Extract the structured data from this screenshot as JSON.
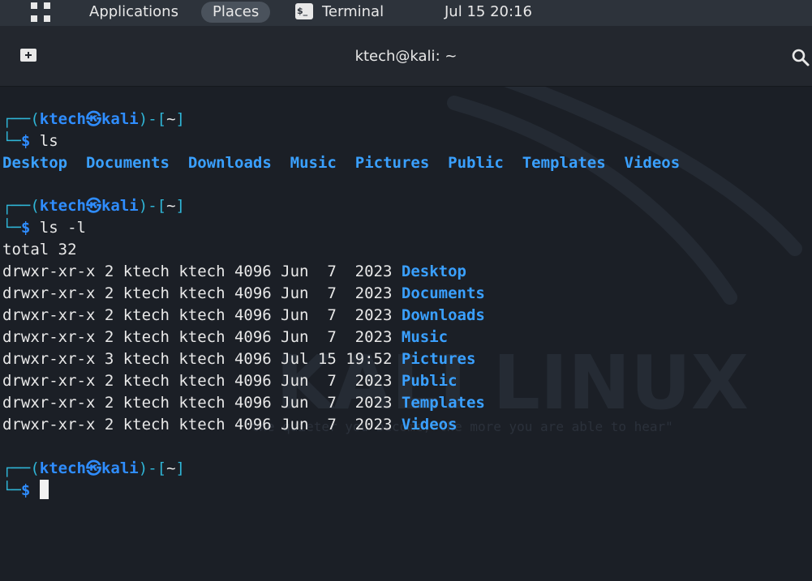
{
  "topbar": {
    "applications": "Applications",
    "places": "Places",
    "terminal": "Terminal",
    "clock": "Jul 15  20:16"
  },
  "window": {
    "title": "ktech@kali: ~"
  },
  "prompt": {
    "open": "┌──(",
    "user": "ktech",
    "at": "㉿",
    "host": "kali",
    "mid": ")-[",
    "dir": "~",
    "close": "]",
    "corner": "└─",
    "dollar": "$"
  },
  "commands": [
    "ls",
    "ls -l"
  ],
  "ls_output": [
    "Desktop",
    "Documents",
    "Downloads",
    "Music",
    "Pictures",
    "Public",
    "Templates",
    "Videos"
  ],
  "total": "total 32",
  "ls_long": [
    {
      "meta": "drwxr-xr-x 2 ktech ktech 4096 Jun  7  2023 ",
      "name": "Desktop"
    },
    {
      "meta": "drwxr-xr-x 2 ktech ktech 4096 Jun  7  2023 ",
      "name": "Documents"
    },
    {
      "meta": "drwxr-xr-x 2 ktech ktech 4096 Jun  7  2023 ",
      "name": "Downloads"
    },
    {
      "meta": "drwxr-xr-x 2 ktech ktech 4096 Jun  7  2023 ",
      "name": "Music"
    },
    {
      "meta": "drwxr-xr-x 3 ktech ktech 4096 Jul 15 19:52 ",
      "name": "Pictures"
    },
    {
      "meta": "drwxr-xr-x 2 ktech ktech 4096 Jun  7  2023 ",
      "name": "Public"
    },
    {
      "meta": "drwxr-xr-x 2 ktech ktech 4096 Jun  7  2023 ",
      "name": "Templates"
    },
    {
      "meta": "drwxr-xr-x 2 ktech ktech 4096 Jun  7  2023 ",
      "name": "Videos"
    }
  ],
  "wallpaper": {
    "logo_text": "KALI LINUX",
    "tagline": "\"the quieter you become, the more you are able to hear\""
  },
  "colors": {
    "background": "#1b1f26",
    "prompt_lines": "#2fb5d6",
    "user_host": "#2f8dff",
    "directory": "#3aa0ff",
    "text": "#e8e8e8"
  }
}
